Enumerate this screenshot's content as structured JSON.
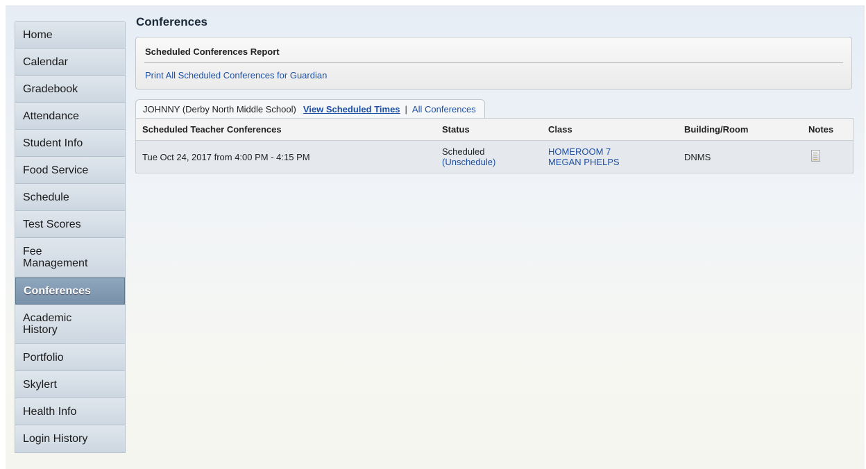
{
  "sidebar": {
    "items": [
      {
        "label": "Home"
      },
      {
        "label": "Calendar"
      },
      {
        "label": "Gradebook"
      },
      {
        "label": "Attendance"
      },
      {
        "label": "Student Info"
      },
      {
        "label": "Food Service"
      },
      {
        "label": "Schedule"
      },
      {
        "label": "Test Scores"
      },
      {
        "label": "Fee Management"
      },
      {
        "label": "Conferences",
        "active": true
      },
      {
        "label": "Academic History"
      },
      {
        "label": "Portfolio"
      },
      {
        "label": "Skylert"
      },
      {
        "label": "Health Info"
      },
      {
        "label": "Login History"
      }
    ]
  },
  "main": {
    "title": "Conferences",
    "report": {
      "title": "Scheduled Conferences Report",
      "link": "Print All Scheduled Conferences for Guardian"
    },
    "tabs": {
      "student": "JOHNNY (Derby North Middle School)",
      "active": "View Scheduled Times",
      "separator": "|",
      "other": "All Conferences"
    },
    "table": {
      "headers": [
        "Scheduled Teacher Conferences",
        "Status",
        "Class",
        "Building/Room",
        "Notes"
      ],
      "rows": [
        {
          "time": "Tue Oct 24, 2017 from 4:00 PM - 4:15 PM",
          "status": "Scheduled",
          "status_action": "(Unschedule)",
          "class_name": "HOMEROOM 7",
          "teacher": "MEGAN PHELPS",
          "room": "DNMS",
          "notes_icon": "notes-icon"
        }
      ]
    }
  },
  "colors": {
    "link": "#1e4fa3",
    "active_nav": "#8197ad"
  }
}
